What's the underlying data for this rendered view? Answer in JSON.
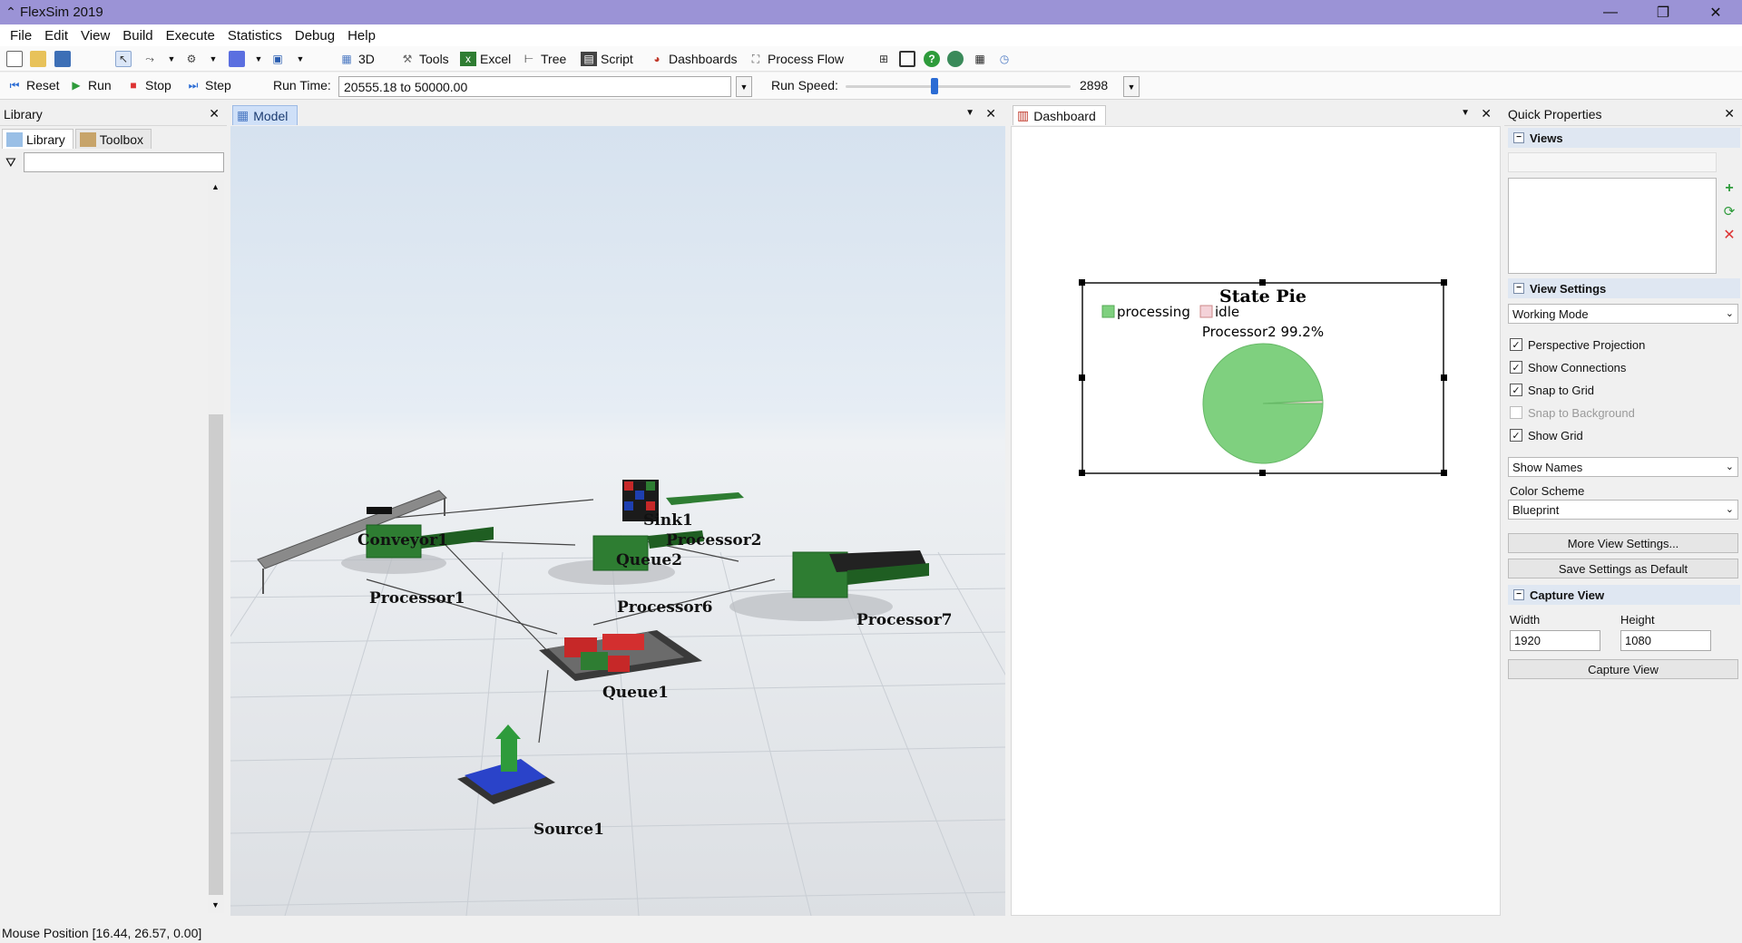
{
  "window": {
    "title": "FlexSim 2019"
  },
  "menu": [
    "File",
    "Edit",
    "View",
    "Build",
    "Execute",
    "Statistics",
    "Debug",
    "Help"
  ],
  "toolbar": {
    "three_d": "3D",
    "tools": "Tools",
    "excel": "Excel",
    "tree": "Tree",
    "script": "Script",
    "dashboards": "Dashboards",
    "process_flow": "Process Flow"
  },
  "run_controls": {
    "reset": "Reset",
    "run": "Run",
    "stop": "Stop",
    "step": "Step",
    "run_time_label": "Run Time:",
    "run_time_value": "20555.18  to  50000.00",
    "run_speed_label": "Run Speed:",
    "run_speed_value": "2898"
  },
  "library": {
    "title": "Library",
    "tabs": [
      "Library",
      "Toolbox"
    ],
    "filter_value": ""
  },
  "model": {
    "tab": "Model",
    "objects": [
      {
        "id": "conveyor1",
        "name": "Conveyor1"
      },
      {
        "id": "processor1",
        "name": "Processor1"
      },
      {
        "id": "sink1",
        "name": "Sink1"
      },
      {
        "id": "processor2",
        "name": "Processor2"
      },
      {
        "id": "queue2",
        "name": "Queue2"
      },
      {
        "id": "processor6",
        "name": "Processor6"
      },
      {
        "id": "processor7",
        "name": "Processor7"
      },
      {
        "id": "queue1",
        "name": "Queue1"
      },
      {
        "id": "source1",
        "name": "Source1"
      }
    ]
  },
  "dashboard": {
    "tab": "Dashboard",
    "chart_data": {
      "type": "pie",
      "title": "State Pie",
      "legend": [
        "processing",
        "idle"
      ],
      "series": [
        {
          "name": "Processor2",
          "label": "Processor2 99.2%",
          "slices": [
            {
              "name": "processing",
              "value": 99.2,
              "color": "#7fd07f"
            },
            {
              "name": "idle",
              "value": 0.8,
              "color": "#f4d2d8"
            }
          ]
        }
      ]
    }
  },
  "quick_properties": {
    "title": "Quick Properties",
    "views_section": "Views",
    "views_name": "",
    "view_settings_section": "View Settings",
    "mode": "Working Mode",
    "checks": [
      {
        "label": "Perspective Projection",
        "checked": true,
        "enabled": true
      },
      {
        "label": "Show Connections",
        "checked": true,
        "enabled": true
      },
      {
        "label": "Snap to Grid",
        "checked": true,
        "enabled": true
      },
      {
        "label": "Snap to Background",
        "checked": false,
        "enabled": false
      },
      {
        "label": "Show Grid",
        "checked": true,
        "enabled": true
      }
    ],
    "show_names": "Show Names",
    "color_scheme_label": "Color Scheme",
    "color_scheme": "Blueprint",
    "more_settings": "More View Settings...",
    "save_default": "Save Settings as Default",
    "capture_section": "Capture View",
    "width_label": "Width",
    "height_label": "Height",
    "width_value": "1920",
    "height_value": "1080",
    "capture_button": "Capture View"
  },
  "status": {
    "mouse_position": "Mouse Position [16.44, 26.57, 0.00]"
  },
  "colors": {
    "title_bar": "#9b93d6",
    "accent": "#2b6cd4",
    "processing": "#7fd07f",
    "idle": "#f4d2d8"
  }
}
